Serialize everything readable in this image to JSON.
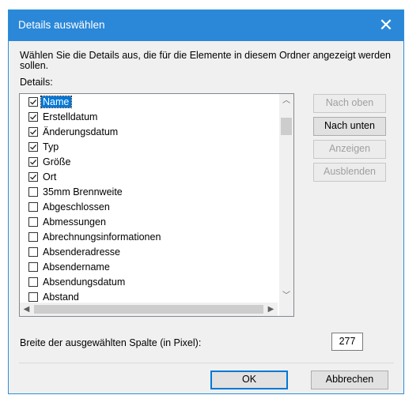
{
  "dialog": {
    "title": "Details auswählen",
    "close_glyph": "✕",
    "description": "Wählen Sie die Details aus, die für die Elemente in diesem Ordner angezeigt werden sollen.",
    "details_label": "Details:"
  },
  "details_list": [
    {
      "label": "Name",
      "checked": true,
      "selected": true
    },
    {
      "label": "Erstelldatum",
      "checked": true,
      "selected": false
    },
    {
      "label": "Änderungsdatum",
      "checked": true,
      "selected": false
    },
    {
      "label": "Typ",
      "checked": true,
      "selected": false
    },
    {
      "label": "Größe",
      "checked": true,
      "selected": false
    },
    {
      "label": "Ort",
      "checked": true,
      "selected": false
    },
    {
      "label": "35mm Brennweite",
      "checked": false,
      "selected": false
    },
    {
      "label": "Abgeschlossen",
      "checked": false,
      "selected": false
    },
    {
      "label": "Abmessungen",
      "checked": false,
      "selected": false
    },
    {
      "label": "Abrechnungsinformationen",
      "checked": false,
      "selected": false
    },
    {
      "label": "Absenderadresse",
      "checked": false,
      "selected": false
    },
    {
      "label": "Absendername",
      "checked": false,
      "selected": false
    },
    {
      "label": "Absendungsdatum",
      "checked": false,
      "selected": false
    },
    {
      "label": "Abstand",
      "checked": false,
      "selected": false
    }
  ],
  "side_buttons": {
    "move_up": "Nach oben",
    "move_down": "Nach unten",
    "show": "Anzeigen",
    "hide": "Ausblenden"
  },
  "width": {
    "label": "Breite der ausgewählten Spalte (in Pixel):",
    "value": "277"
  },
  "footer": {
    "ok": "OK",
    "cancel": "Abbrechen"
  },
  "icons": {
    "close": "close-icon",
    "checkmark": "checkmark-icon",
    "scroll_up": "chevron-up-icon",
    "scroll_down": "chevron-down-icon",
    "scroll_left": "chevron-left-icon",
    "scroll_right": "chevron-right-icon"
  },
  "colors": {
    "titlebar": "#2b88d8",
    "selection": "#0078d7",
    "dialog_bg": "#f0f0f0"
  }
}
